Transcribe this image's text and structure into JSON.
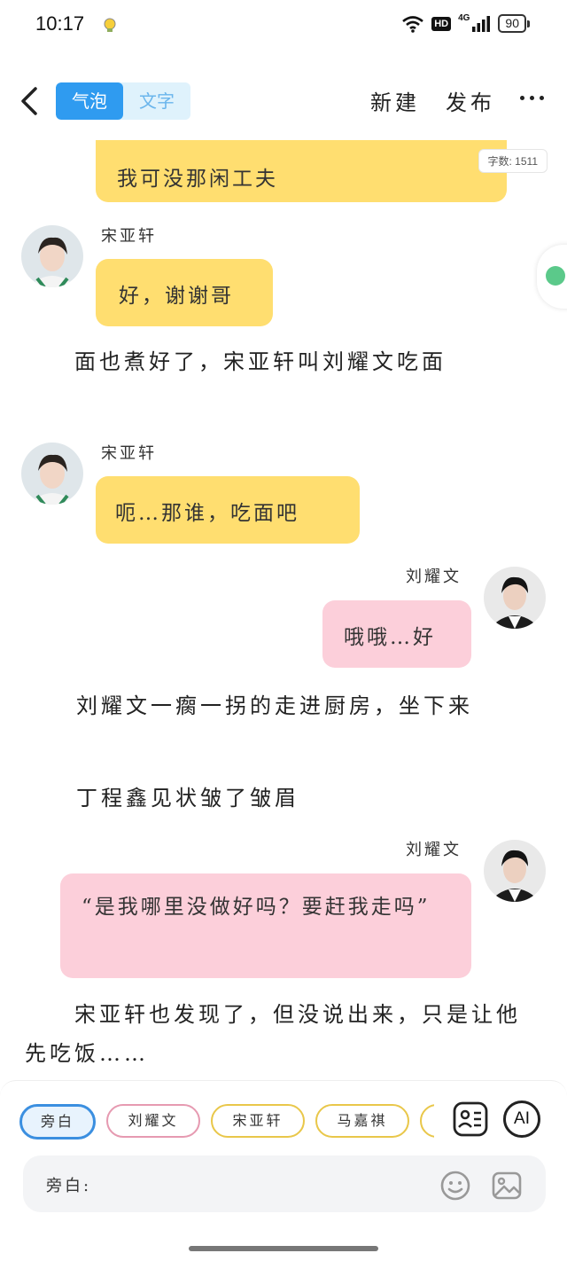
{
  "status_bar": {
    "time": "10:17",
    "hd": "HD",
    "signal_label": "4G",
    "battery": "90"
  },
  "header": {
    "tabs": [
      {
        "label": "气泡",
        "active": true
      },
      {
        "label": "文字",
        "active": false
      }
    ],
    "new_label": "新建",
    "publish_label": "发布"
  },
  "messages": {
    "m1": {
      "text": "我可没那闲工夫",
      "word_count": "字数: 1511"
    },
    "m2": {
      "name": "宋亚轩",
      "text": "好，谢谢哥"
    },
    "n1": "　　面也煮好了，宋亚轩叫刘耀文吃面",
    "m3": {
      "name": "宋亚轩",
      "text": "呃…那谁，吃面吧"
    },
    "m4": {
      "name": "刘耀文",
      "text": "哦哦…好"
    },
    "n2": "　　刘耀文一瘸一拐的走进厨房，坐下来",
    "n3": "　　丁程鑫见状皱了皱眉",
    "m5": {
      "name": "刘耀文",
      "text": "“是我哪里没做好吗？要赶我走吗”"
    },
    "n4": "　　宋亚轩也发现了，但没说出来，只是让他先吃饭……"
  },
  "bottom": {
    "chips": [
      "旁白",
      "刘耀文",
      "宋亚轩",
      "马嘉祺"
    ],
    "ai_label": "AI",
    "input_label": "旁白:",
    "input_value": ""
  },
  "colors": {
    "yellow_bubble": "#ffde70",
    "pink_bubble": "#fccfda",
    "accent_blue": "#2f9bf0"
  },
  "icons": [
    "back-arrow-icon",
    "more-icon",
    "character-card-icon",
    "emoji-icon",
    "image-icon",
    "wifi-icon",
    "signal-icon",
    "battery-icon"
  ]
}
